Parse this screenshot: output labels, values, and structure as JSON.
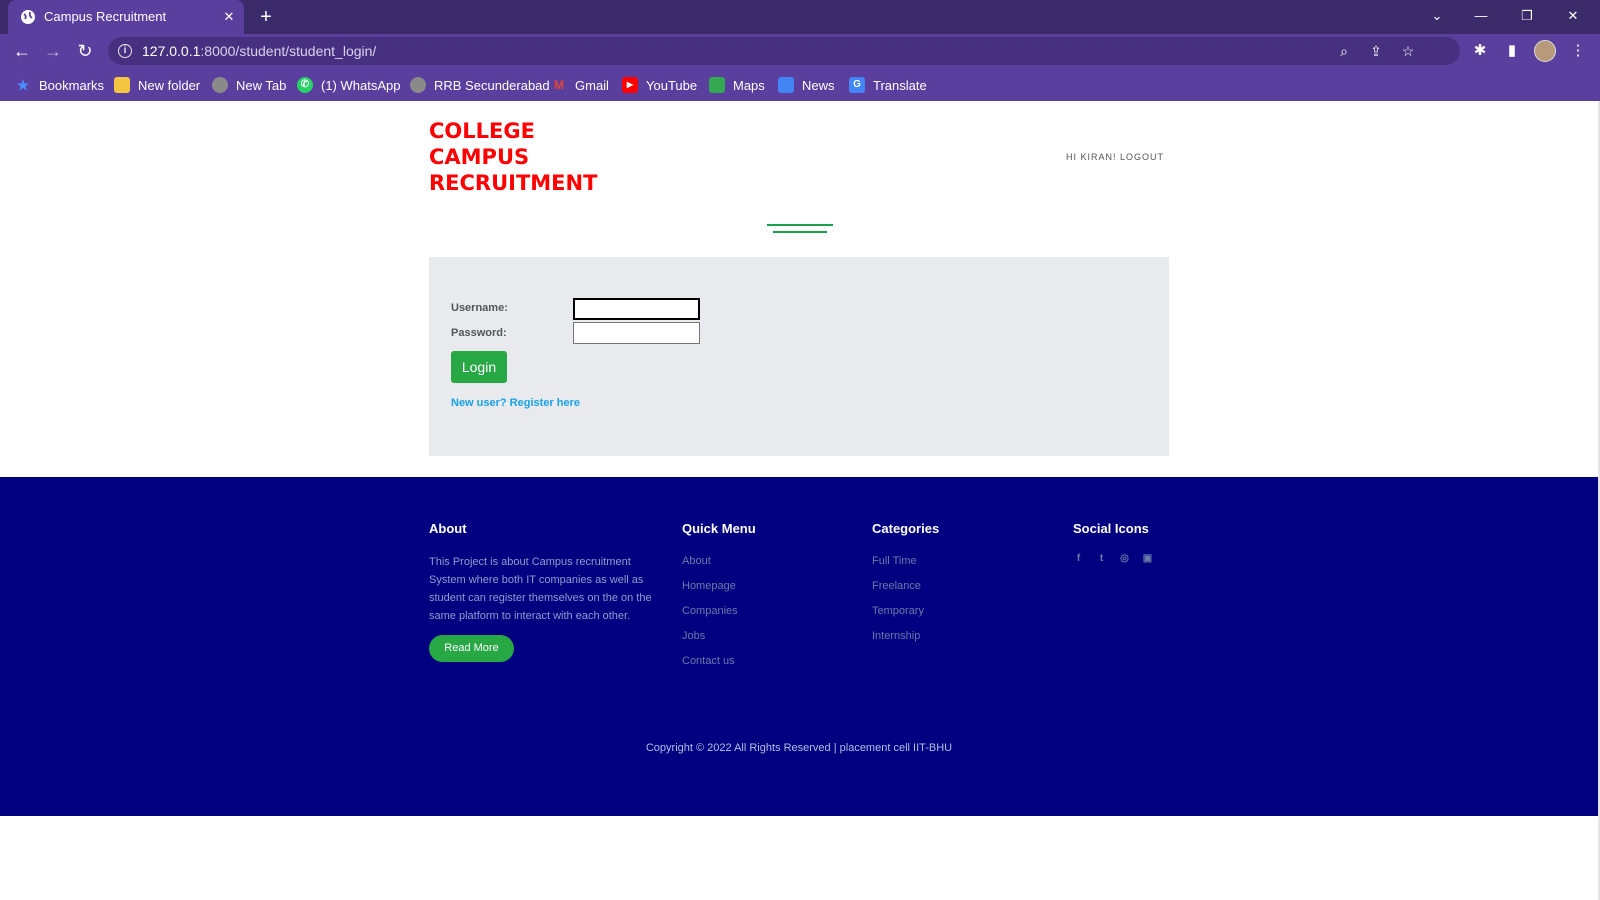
{
  "browser": {
    "tab_title": "Campus Recruitment",
    "tab_close": "✕",
    "new_tab": "+",
    "url_host": "127.0.0.1",
    "url_path": ":8000/student/student_login/",
    "bookmarks": [
      {
        "label": "Bookmarks",
        "icon": "star-icon",
        "color": "#4a8cff"
      },
      {
        "label": "New folder",
        "icon": "folder-icon",
        "color": "#f5c542"
      },
      {
        "label": "New Tab",
        "icon": "globe-icon",
        "color": "#8a8a8a"
      },
      {
        "label": "(1) WhatsApp",
        "icon": "whatsapp-icon",
        "color": "#25d366"
      },
      {
        "label": "RRB Secunderabad",
        "icon": "globe-icon",
        "color": "#8a8a8a"
      },
      {
        "label": "Gmail",
        "icon": "gmail-icon",
        "color": "#ea4335"
      },
      {
        "label": "YouTube",
        "icon": "youtube-icon",
        "color": "#ff0000"
      },
      {
        "label": "Maps",
        "icon": "maps-icon",
        "color": "#34a853"
      },
      {
        "label": "News",
        "icon": "news-icon",
        "color": "#4285f4"
      },
      {
        "label": "Translate",
        "icon": "translate-icon",
        "color": "#4285f4"
      }
    ]
  },
  "header": {
    "brand_lines": [
      "COLLEGE",
      "CAMPUS",
      "RECRUITMENT"
    ],
    "user_link": "HI KIRAN! LOGOUT",
    "brand_color": "#ff0000"
  },
  "login": {
    "username_label": "Username:",
    "password_label": "Password:",
    "username_value": "",
    "password_value": "",
    "login_button": "Login",
    "register_link": "New user? Register here"
  },
  "footer": {
    "about": {
      "heading": "About",
      "text": "This Project is about Campus recruitment System where both IT companies as well as student can register themselves on the on the same platform to interact with each other.",
      "button": "Read More"
    },
    "quick_menu": {
      "heading": "Quick Menu",
      "items": [
        "About",
        "Homepage",
        "Companies",
        "Jobs",
        "Contact us"
      ]
    },
    "categories": {
      "heading": "Categories",
      "items": [
        "Full Time",
        "Freelance",
        "Temporary",
        "Internship"
      ]
    },
    "social": {
      "heading": "Social Icons",
      "icons": [
        "facebook-icon",
        "twitter-icon",
        "instagram-icon",
        "youtube-icon"
      ]
    },
    "copyright": "Copyright © 2022 All Rights Reserved | placement cell IIT-BHU",
    "bg_color": "#000080",
    "accent_color": "#28a745"
  }
}
